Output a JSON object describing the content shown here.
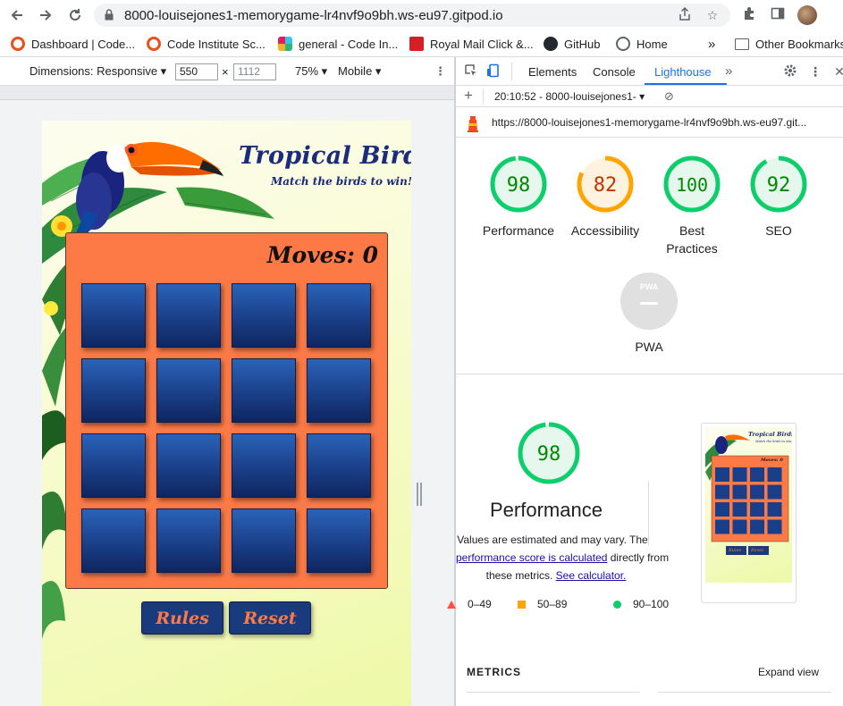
{
  "browser": {
    "url": "8000-louisejones1-memorygame-lr4nvf9o9bh.ws-eu97.gitpod.io",
    "bookmarks": [
      {
        "label": "Dashboard | Code...",
        "color": "#e8501c"
      },
      {
        "label": "Code Institute Sc...",
        "color": "#e8501c"
      },
      {
        "label": "general - Code In...",
        "color": "#611f69"
      },
      {
        "label": "Royal Mail Click &...",
        "color": "#d91f26"
      },
      {
        "label": "GitHub",
        "color": "#24292f"
      },
      {
        "label": "Home",
        "color": "#5f6368"
      }
    ],
    "more_bookmarks": "»",
    "other_bookmarks": "Other Bookmarks"
  },
  "device_toolbar": {
    "dimensions_label": "Dimensions: Responsive ▾",
    "width_value": "550",
    "times": "×",
    "height_value": "1112",
    "zoom": "75% ▾",
    "device_type": "Mobile ▾"
  },
  "game": {
    "title": "Tropical Birds",
    "subtitle": "Match the birds to win!",
    "moves_label": "Moves:",
    "moves_value": "0",
    "card_count": 16,
    "rules_button": "Rules",
    "reset_button": "Reset",
    "colors": {
      "board": "#fd7a47",
      "card": "#1a3f88",
      "title": "#1a2c7a"
    }
  },
  "devtools": {
    "tabs": [
      "Elements",
      "Console",
      "Lighthouse"
    ],
    "active_tab": "Lighthouse",
    "more_tabs": "»",
    "report_time": "20:10:52 - 8000-louisejones1-",
    "report_url": "https://8000-louisejones1-memorygame-lr4nvf9o9bh.ws-eu97.git...",
    "scores": [
      {
        "label": "Performance",
        "value": "98",
        "color": "#0cce6b",
        "fill": "#e6f8ee",
        "text": "#008800",
        "fraction": 0.98
      },
      {
        "label": "Accessibility",
        "value": "82",
        "color": "#ffa400",
        "fill": "#fff3e0",
        "text": "#c33300",
        "fraction": 0.82
      },
      {
        "label": "Best Practices",
        "value": "100",
        "color": "#0cce6b",
        "fill": "#e6f8ee",
        "text": "#008800",
        "fraction": 1.0
      },
      {
        "label": "SEO",
        "value": "92",
        "color": "#0cce6b",
        "fill": "#e6f8ee",
        "text": "#008800",
        "fraction": 0.92
      }
    ],
    "pwa": {
      "label": "PWA",
      "badge": "PWA"
    },
    "performance": {
      "value": "98",
      "title": "Performance",
      "desc_line1": "Values are estimated and may vary. The",
      "desc_link": "performance score is calculated",
      "desc_after_link": " directly from",
      "desc_line3": "these metrics. ",
      "see_calc": "See calculator."
    },
    "legend": [
      {
        "range": "0–49",
        "color": "#ff4e42",
        "shape": "triangle"
      },
      {
        "range": "50–89",
        "color": "#ffa400",
        "shape": "square"
      },
      {
        "range": "90–100",
        "color": "#0cce6b",
        "shape": "circle"
      }
    ],
    "metrics_label": "METRICS",
    "expand_view": "Expand view"
  }
}
